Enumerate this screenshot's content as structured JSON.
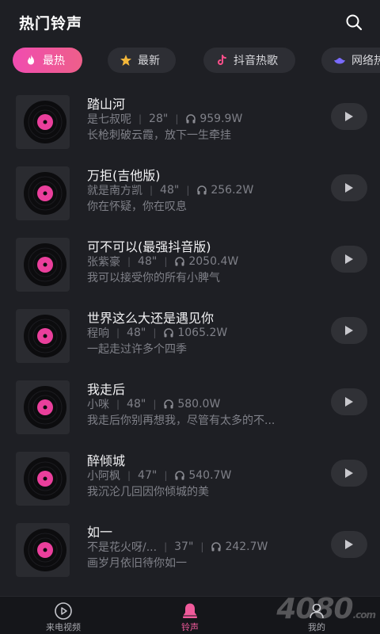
{
  "header": {
    "title": "热门铃声"
  },
  "tabs": [
    {
      "label": "最热",
      "icon": "fire-icon",
      "active": true
    },
    {
      "label": "最新",
      "icon": "star-icon",
      "active": false
    },
    {
      "label": "抖音热歌",
      "icon": "douyin-icon",
      "active": false
    },
    {
      "label": "网络热",
      "icon": "hat-icon",
      "active": false
    }
  ],
  "songs": [
    {
      "title": "踏山河",
      "artist": "是七叔呢",
      "duration": "28\"",
      "plays": "959.9W",
      "lyric": "长枪刺破云霞，放下一生牵挂"
    },
    {
      "title": "万拒(吉他版)",
      "artist": "就是南方凯",
      "duration": "48\"",
      "plays": "256.2W",
      "lyric": "你在怀疑，你在叹息"
    },
    {
      "title": "可不可以(最强抖音版)",
      "artist": "张紫豪",
      "duration": "48\"",
      "plays": "2050.4W",
      "lyric": "我可以接受你的所有小脾气"
    },
    {
      "title": "世界这么大还是遇见你",
      "artist": "程响",
      "duration": "48\"",
      "plays": "1065.2W",
      "lyric": "一起走过许多个四季"
    },
    {
      "title": "我走后",
      "artist": "小咪",
      "duration": "48\"",
      "plays": "580.0W",
      "lyric": "我走后你别再想我，尽管有太多的不..."
    },
    {
      "title": "醉倾城",
      "artist": "小阿枫",
      "duration": "47\"",
      "plays": "540.7W",
      "lyric": "我沉沦几回因你倾城的美"
    },
    {
      "title": "如一",
      "artist": "不是花火呀/...",
      "duration": "37\"",
      "plays": "242.7W",
      "lyric": "画岁月依旧待你如一"
    }
  ],
  "bottom_nav": [
    {
      "label": "来电视频",
      "icon": "video-icon",
      "active": false
    },
    {
      "label": "铃声",
      "icon": "bell-icon",
      "active": true
    },
    {
      "label": "我的",
      "icon": "user-icon",
      "active": false
    }
  ],
  "watermark": {
    "text": "4080",
    "suffix": ".com"
  },
  "colors": {
    "accent": "#f04cb0",
    "background": "#1e1f24"
  }
}
